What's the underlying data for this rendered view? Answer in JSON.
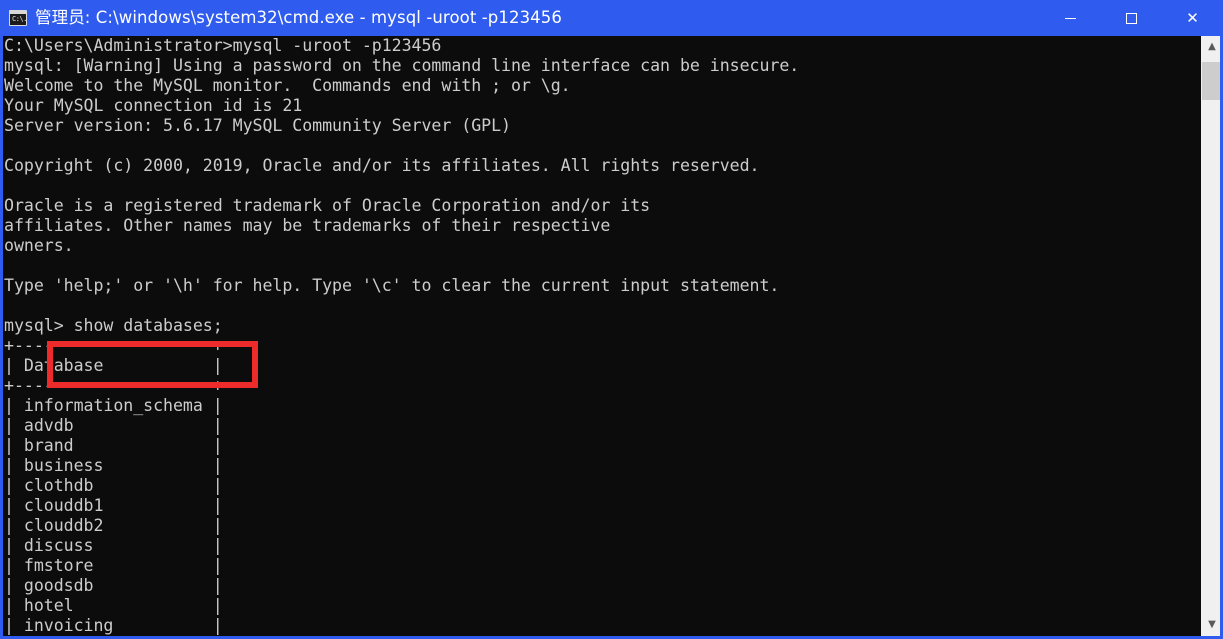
{
  "window": {
    "title": "管理员: C:\\windows\\system32\\cmd.exe - mysql  -uroot -p123456",
    "icon_name": "cmd-icon",
    "icon_text": "C:\\.",
    "titlebar_color": "#2F5CEE",
    "background_color": "#0C0C0C",
    "text_color": "#CCCCCC",
    "controls": {
      "minimize_label": "—",
      "maximize_label": "☐",
      "close_label": "✕"
    }
  },
  "console": {
    "lines": [
      "C:\\Users\\Administrator>mysql -uroot -p123456",
      "mysql: [Warning] Using a password on the command line interface can be insecure.",
      "Welcome to the MySQL monitor.  Commands end with ; or \\g.",
      "Your MySQL connection id is 21",
      "Server version: 5.6.17 MySQL Community Server (GPL)",
      "",
      "Copyright (c) 2000, 2019, Oracle and/or its affiliates. All rights reserved.",
      "",
      "Oracle is a registered trademark of Oracle Corporation and/or its",
      "affiliates. Other names may be trademarks of their respective",
      "owners.",
      "",
      "Type 'help;' or '\\h' for help. Type '\\c' to clear the current input statement.",
      "",
      "mysql> show databases;",
      "+--------------------+",
      "| Database           |",
      "+--------------------+",
      "| information_schema |",
      "| advdb              |",
      "| brand              |",
      "| business           |",
      "| clothdb            |",
      "| clouddb1           |",
      "| clouddb2           |",
      "| discuss            |",
      "| fmstore            |",
      "| goodsdb            |",
      "| hotel              |",
      "| invoicing          |"
    ],
    "prompt": "mysql>",
    "command": "show databases;",
    "table_header": "Database",
    "databases": [
      "information_schema",
      "advdb",
      "brand",
      "business",
      "clothdb",
      "clouddb1",
      "clouddb2",
      "discuss",
      "fmstore",
      "goodsdb",
      "hotel",
      "invoicing"
    ]
  },
  "annotation": {
    "name": "red-highlight-box",
    "color": "#EE2B2B",
    "targets": "mysql> show databases;"
  },
  "scrollbar": {
    "up_arrow": "▲",
    "down_arrow": "▼"
  }
}
